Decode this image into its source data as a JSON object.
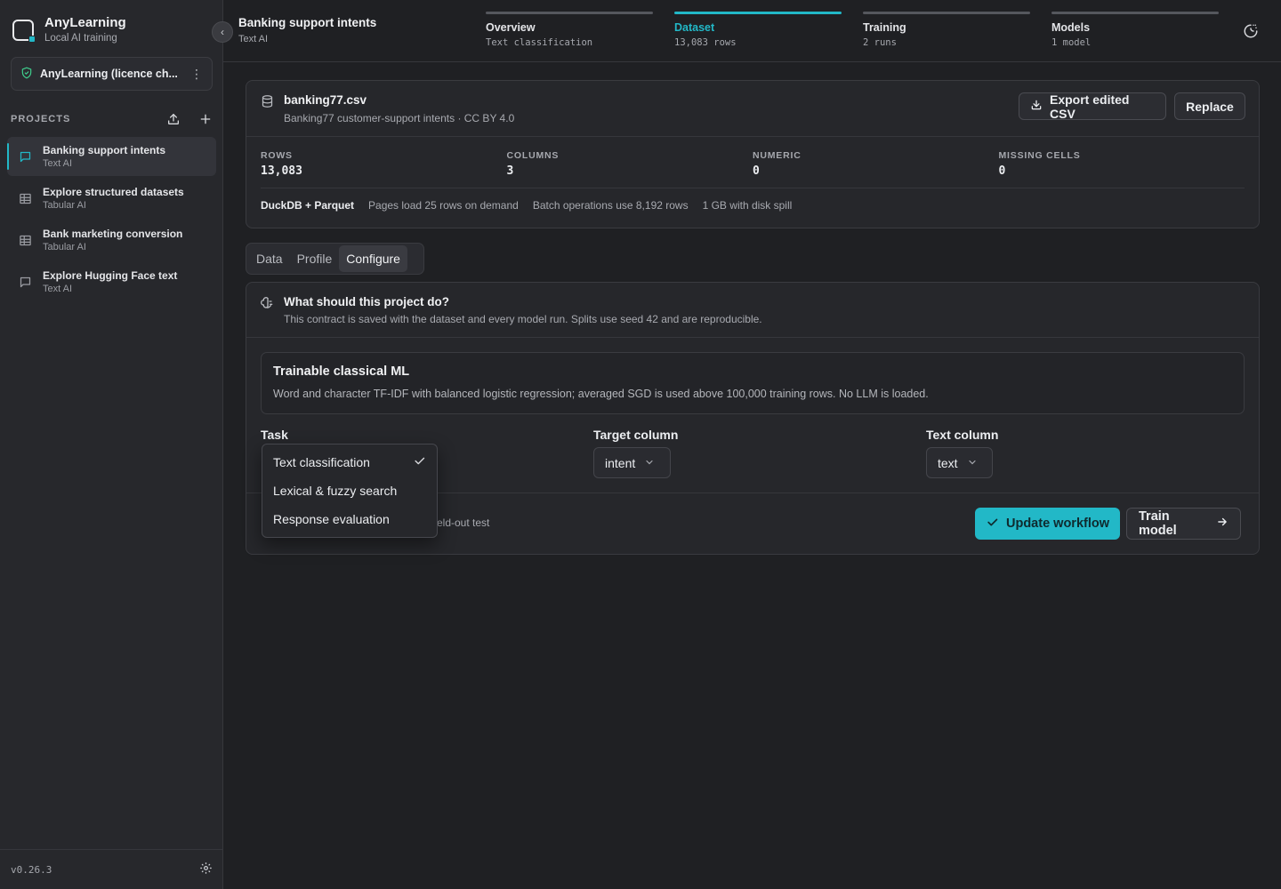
{
  "app": {
    "name": "AnyLearning",
    "subtitle": "Local AI training",
    "licence": "AnyLearning (licence ch...",
    "version": "v0.26.3",
    "accent_color": "#22b8c7"
  },
  "sidebar": {
    "projects_label": "PROJECTS",
    "projects": [
      {
        "name": "Banking support intents",
        "type": "Text AI",
        "icon": "chat-icon",
        "active": true
      },
      {
        "name": "Explore structured datasets",
        "type": "Tabular AI",
        "icon": "table-icon",
        "active": false
      },
      {
        "name": "Bank marketing conversion",
        "type": "Tabular AI",
        "icon": "table-icon",
        "active": false
      },
      {
        "name": "Explore Hugging Face text",
        "type": "Text AI",
        "icon": "chat-icon",
        "active": false
      }
    ]
  },
  "header": {
    "title": "Banking support intents",
    "subtitle": "Text AI",
    "steps": [
      {
        "name": "Overview",
        "meta": "Text classification",
        "active": false
      },
      {
        "name": "Dataset",
        "meta": "13,083 rows",
        "active": true
      },
      {
        "name": "Training",
        "meta": "2 runs",
        "active": false
      },
      {
        "name": "Models",
        "meta": "1 model",
        "active": false
      }
    ]
  },
  "dataset": {
    "filename": "banking77.csv",
    "description": "Banking77 customer-support intents · CC BY 4.0",
    "export_label": "Export edited CSV",
    "replace_label": "Replace",
    "stats": [
      {
        "key": "ROWS",
        "value": "13,083"
      },
      {
        "key": "COLUMNS",
        "value": "3"
      },
      {
        "key": "NUMERIC",
        "value": "0"
      },
      {
        "key": "MISSING CELLS",
        "value": "0"
      }
    ],
    "engine": "DuckDB + Parquet",
    "engine_notes": [
      "Pages load 25 rows on demand",
      "Batch operations use 8,192 rows",
      "1 GB with disk spill"
    ]
  },
  "tabs": [
    {
      "label": "Data",
      "active": false
    },
    {
      "label": "Profile",
      "active": false
    },
    {
      "label": "Configure",
      "active": true
    }
  ],
  "configure": {
    "title": "What should this project do?",
    "description": "This contract is saved with the dataset and every model run. Splits use seed 42 and are reproducible.",
    "method_title": "Trainable classical ML",
    "method_desc": "Word and character TF-IDF with balanced logistic regression; averaged SGD is used above 100,000 training rows. No LLM is loaded.",
    "task_label": "Task",
    "target_label": "Target column",
    "target_value": "intent",
    "text_label": "Text column",
    "text_value": "text",
    "split_note_visible": "eld-out test",
    "update_label": "Update workflow",
    "train_label": "Train model",
    "task_options": [
      {
        "label": "Text classification",
        "selected": true
      },
      {
        "label": "Lexical & fuzzy search",
        "selected": false
      },
      {
        "label": "Response evaluation",
        "selected": false
      }
    ]
  }
}
